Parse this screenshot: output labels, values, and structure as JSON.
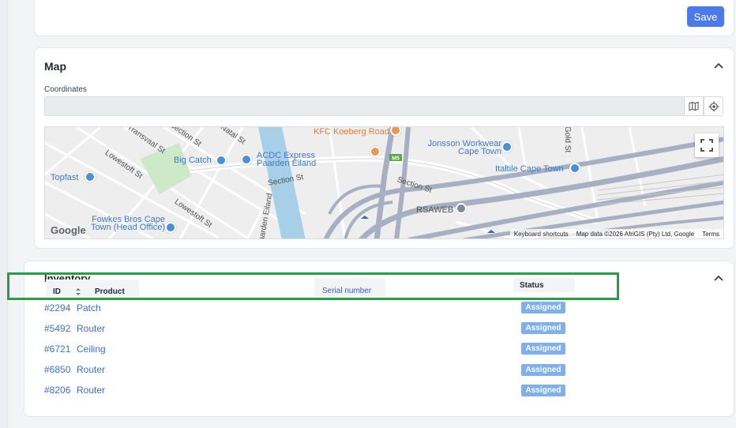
{
  "toolbar": {
    "save_label": "Save"
  },
  "map_section": {
    "title": "Map",
    "coordinates_label": "Coordinates",
    "coordinates_value": "",
    "map_view": {
      "places": [
        "KFC Koeberg Road",
        "Jonsson Workwear Cape Town",
        "Big Catch",
        "ACDC Express Paarden Eiland",
        "Topfast",
        "Italtile Cape Town",
        "RSAWEB",
        "Fowkes Bros Cape Town (Head Office)"
      ],
      "streets": [
        "Section St",
        "Transvaal St",
        "Lowestoft St",
        "Natal St",
        "Gold St",
        "Paarden Eiland"
      ],
      "road_badge": "M5",
      "google_logo": "Google",
      "keyboard_shortcuts": "Keyboard shortcuts",
      "map_data": "Map data ©2026 AfriGIS (Pty) Ltd, Google",
      "terms": "Terms"
    }
  },
  "inventory": {
    "title": "Inventory",
    "columns": {
      "id": "ID",
      "product": "Product",
      "serial": "Serial number",
      "status": "Status"
    },
    "rows": [
      {
        "id": "#2294",
        "product": "Patch",
        "status": "Assigned"
      },
      {
        "id": "#5492",
        "product": "Router",
        "status": "Assigned"
      },
      {
        "id": "#6721",
        "product": "Ceiling",
        "status": "Assigned"
      },
      {
        "id": "#6850",
        "product": "Router",
        "status": "Assigned"
      },
      {
        "id": "#8206",
        "product": "Router",
        "status": "Assigned"
      }
    ]
  },
  "colors": {
    "accent": "#4a7be8",
    "link": "#3b6fd0",
    "badge": "#7fb0ec",
    "highlight": "#22a042"
  }
}
